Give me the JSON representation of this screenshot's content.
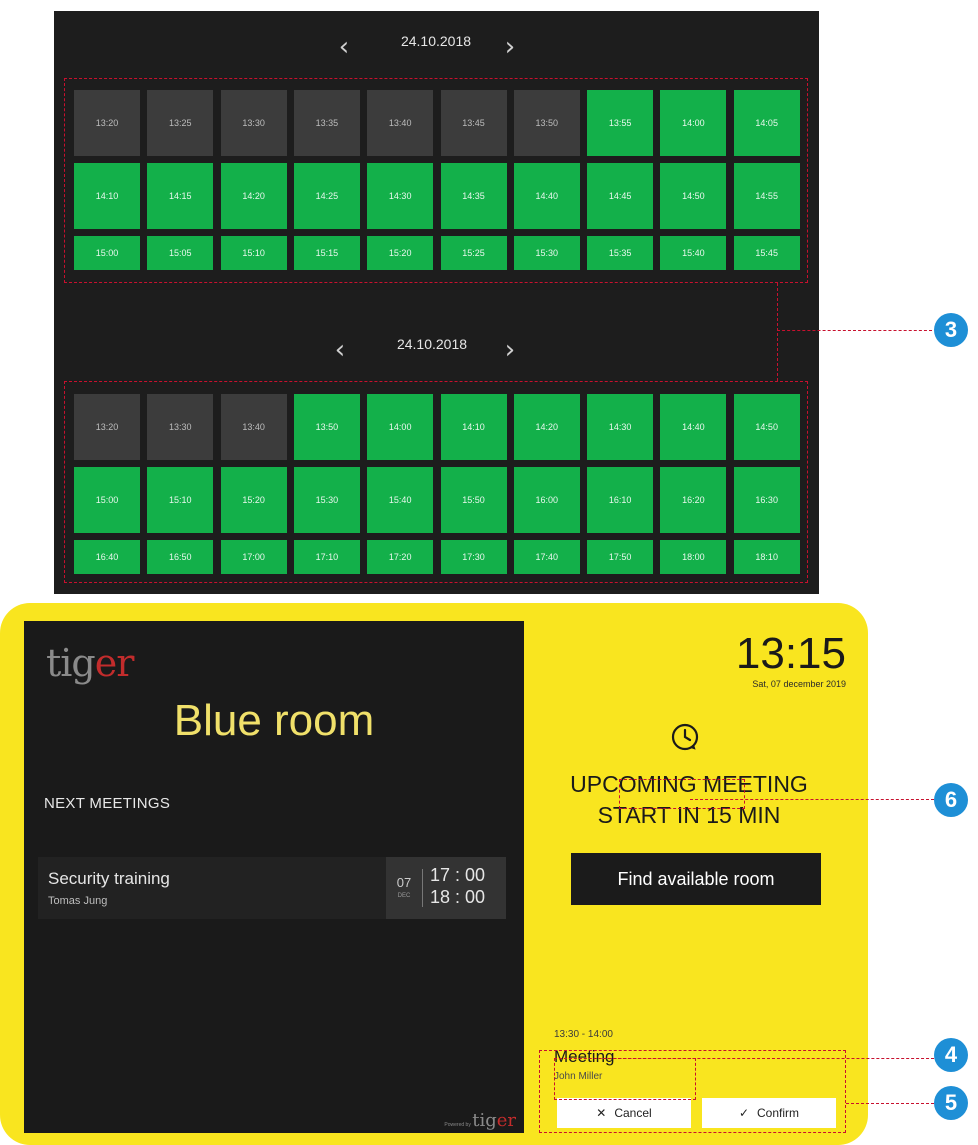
{
  "slot_picker_top": {
    "date": "24.10.2018",
    "slots": [
      {
        "time": "13:20",
        "status": "busy"
      },
      {
        "time": "13:25",
        "status": "busy"
      },
      {
        "time": "13:30",
        "status": "busy"
      },
      {
        "time": "13:35",
        "status": "busy"
      },
      {
        "time": "13:40",
        "status": "busy"
      },
      {
        "time": "13:45",
        "status": "busy"
      },
      {
        "time": "13:50",
        "status": "busy"
      },
      {
        "time": "13:55",
        "status": "free"
      },
      {
        "time": "14:00",
        "status": "free"
      },
      {
        "time": "14:05",
        "status": "free"
      },
      {
        "time": "14:10",
        "status": "free"
      },
      {
        "time": "14:15",
        "status": "free"
      },
      {
        "time": "14:20",
        "status": "free"
      },
      {
        "time": "14:25",
        "status": "free"
      },
      {
        "time": "14:30",
        "status": "free"
      },
      {
        "time": "14:35",
        "status": "free"
      },
      {
        "time": "14:40",
        "status": "free"
      },
      {
        "time": "14:45",
        "status": "free"
      },
      {
        "time": "14:50",
        "status": "free"
      },
      {
        "time": "14:55",
        "status": "free"
      },
      {
        "time": "15:00",
        "status": "free"
      },
      {
        "time": "15:05",
        "status": "free"
      },
      {
        "time": "15:10",
        "status": "free"
      },
      {
        "time": "15:15",
        "status": "free"
      },
      {
        "time": "15:20",
        "status": "free"
      },
      {
        "time": "15:25",
        "status": "free"
      },
      {
        "time": "15:30",
        "status": "free"
      },
      {
        "time": "15:35",
        "status": "free"
      },
      {
        "time": "15:40",
        "status": "free"
      },
      {
        "time": "15:45",
        "status": "free"
      }
    ]
  },
  "slot_picker_bottom": {
    "date": "24.10.2018",
    "slots": [
      {
        "time": "13:20",
        "status": "busy"
      },
      {
        "time": "13:30",
        "status": "busy"
      },
      {
        "time": "13:40",
        "status": "busy"
      },
      {
        "time": "13:50",
        "status": "free"
      },
      {
        "time": "14:00",
        "status": "free"
      },
      {
        "time": "14:10",
        "status": "free"
      },
      {
        "time": "14:20",
        "status": "free"
      },
      {
        "time": "14:30",
        "status": "free"
      },
      {
        "time": "14:40",
        "status": "free"
      },
      {
        "time": "14:50",
        "status": "free"
      },
      {
        "time": "15:00",
        "status": "free"
      },
      {
        "time": "15:10",
        "status": "free"
      },
      {
        "time": "15:20",
        "status": "free"
      },
      {
        "time": "15:30",
        "status": "free"
      },
      {
        "time": "15:40",
        "status": "free"
      },
      {
        "time": "15:50",
        "status": "free"
      },
      {
        "time": "16:00",
        "status": "free"
      },
      {
        "time": "16:10",
        "status": "free"
      },
      {
        "time": "16:20",
        "status": "free"
      },
      {
        "time": "16:30",
        "status": "free"
      },
      {
        "time": "16:40",
        "status": "free"
      },
      {
        "time": "16:50",
        "status": "free"
      },
      {
        "time": "17:00",
        "status": "free"
      },
      {
        "time": "17:10",
        "status": "free"
      },
      {
        "time": "17:20",
        "status": "free"
      },
      {
        "time": "17:30",
        "status": "free"
      },
      {
        "time": "17:40",
        "status": "free"
      },
      {
        "time": "17:50",
        "status": "free"
      },
      {
        "time": "18:00",
        "status": "free"
      },
      {
        "time": "18:10",
        "status": "free"
      }
    ]
  },
  "icons": {
    "prev": "chevron-left-icon",
    "next": "chevron-right-icon",
    "clock": "clock-icon",
    "cancel": "close-icon",
    "confirm": "checkmark-icon"
  },
  "callouts": {
    "slots": "3",
    "cancel": "4",
    "confirm": "5",
    "countdown": "6"
  },
  "colors": {
    "free_slot": "#13b04a",
    "busy_slot": "#3c3c3c",
    "tablet_frame": "#f9e51f",
    "room_name": "#f0e06a",
    "annotation": "#c8102e",
    "callout": "#1e8fd6"
  },
  "room_display": {
    "logo_part1": "tig",
    "logo_part2": "er",
    "room_name": "Blue room",
    "next_meetings_label": "NEXT MEETINGS",
    "next_meeting": {
      "title": "Security training",
      "organizer": "Tomas Jung",
      "day": "07",
      "month": "DEC",
      "start": "17 : 00",
      "end": "18 : 00"
    },
    "powered_by": "Powered by",
    "clock": {
      "time": "13:15",
      "date": "Sat, 07 december 2019"
    },
    "status_line1": "UPCOMING MEETING",
    "status_line2_prefix": "START IN",
    "countdown_minutes": "15",
    "status_line2_suffix": "MIN",
    "find_room_label": "Find available room",
    "upcoming_slot": {
      "time": "13:30 - 14:00",
      "title": "Meeting",
      "organizer": "John Miller"
    },
    "cancel_label": "Cancel",
    "confirm_label": "Confirm"
  }
}
